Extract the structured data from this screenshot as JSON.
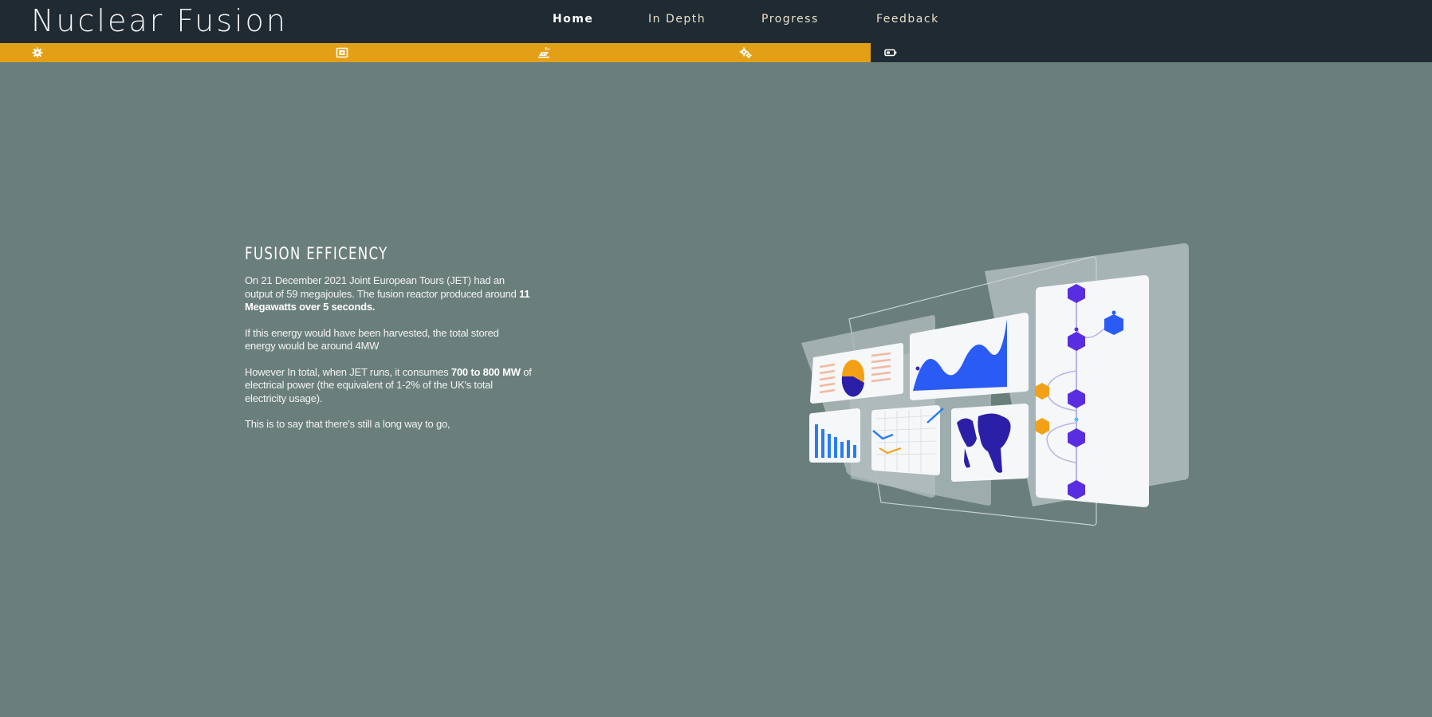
{
  "header": {
    "brand": "Nuclear Fusion",
    "nav": [
      {
        "label": "Home",
        "active": true
      },
      {
        "label": "In Depth",
        "active": false
      },
      {
        "label": "Progress",
        "active": false
      },
      {
        "label": "Feedback",
        "active": false
      }
    ]
  },
  "iconbar": {
    "icons": [
      "gear-icon",
      "radiation-box-icon",
      "solar-panel-icon",
      "gears-icon",
      "battery-icon"
    ],
    "accent": "#e39f16",
    "dark": "#1f2a33"
  },
  "main": {
    "title": "FUSION EFFICENCY",
    "p1_a": "On 21 December 2021 Joint European Tours (JET) had an output of 59 megajoules. The fusion reactor produced around ",
    "p1_b": "11 Megawatts over 5 seconds.",
    "p2": "If this energy would have been harvested, the total stored energy would be around 4MW",
    "p3_a": "However In total, when JET runs, it consumes ",
    "p3_b": "700 to 800 MW",
    "p3_c": " of electrical power (the equivalent of 1-2% of the UK's total electricity usage).",
    "p4": "This is to say that there's still a long way to go,"
  },
  "colors": {
    "background": "#6a7f7c",
    "header": "#1f2a33",
    "accent": "#e39f16"
  }
}
